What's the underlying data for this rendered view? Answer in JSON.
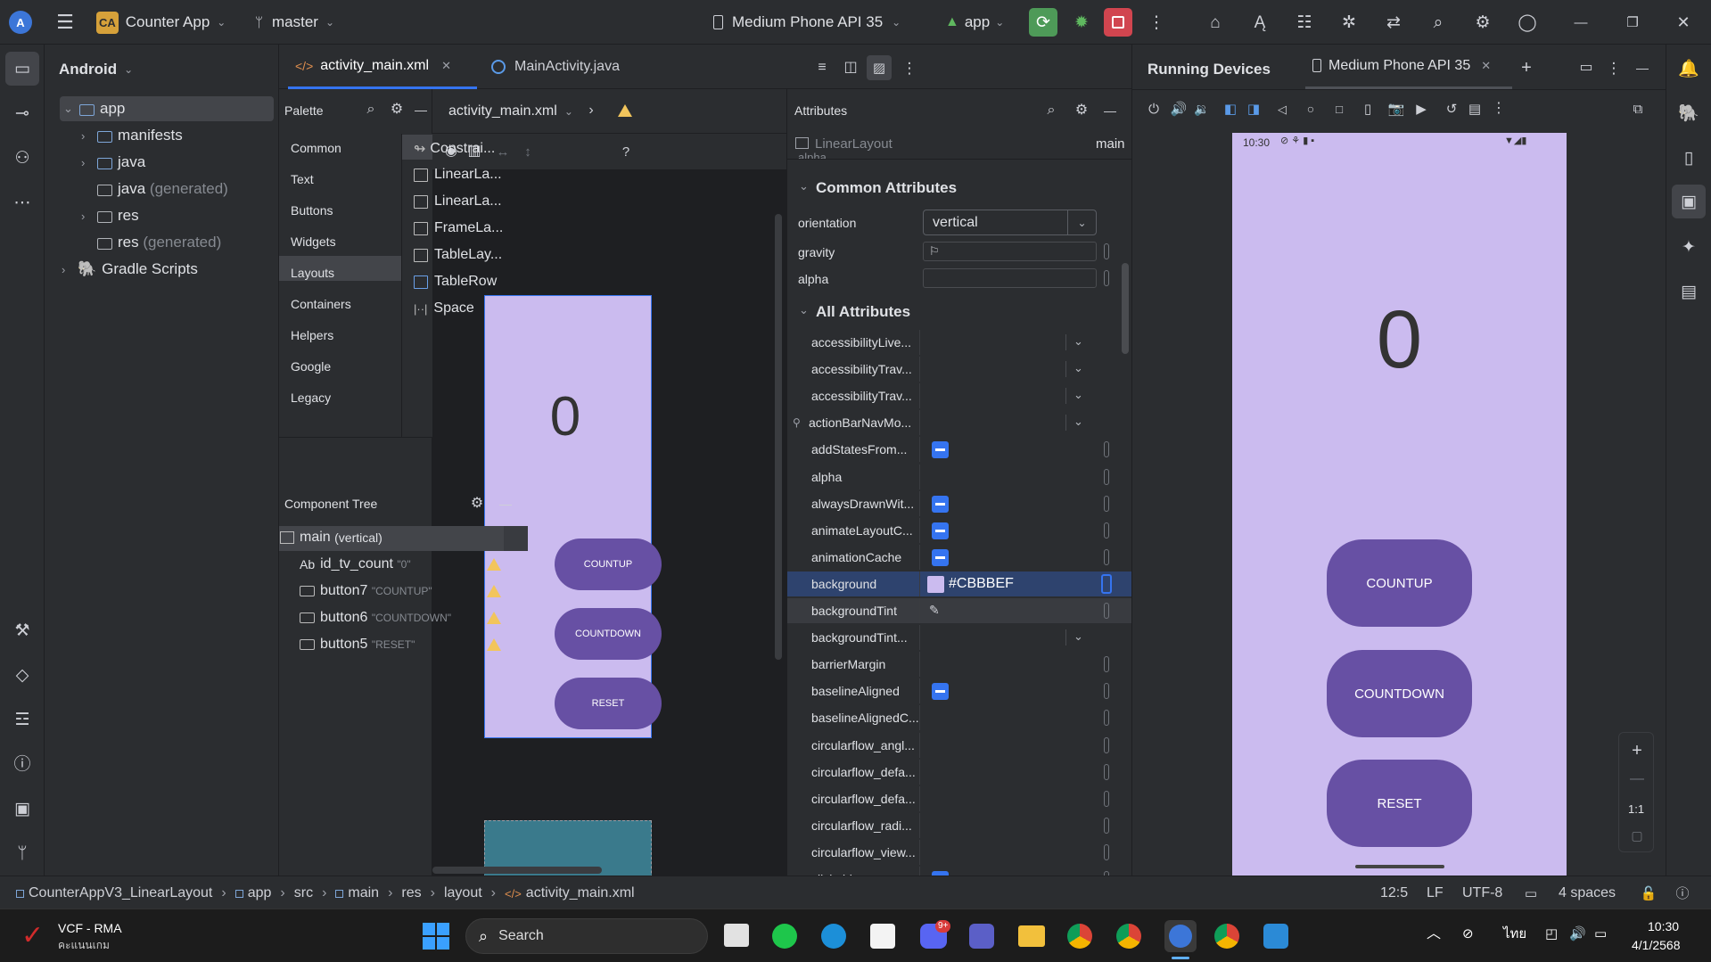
{
  "titlebar": {
    "project_badge": "CA",
    "project": "Counter App",
    "branch": "master",
    "device": "Medium Phone API 35",
    "run_config": "app"
  },
  "project_panel": {
    "view": "Android",
    "items": [
      {
        "label": "app",
        "suffix": ""
      },
      {
        "label": "manifests",
        "suffix": ""
      },
      {
        "label": "java",
        "suffix": ""
      },
      {
        "label": "java",
        "suffix": "(generated)"
      },
      {
        "label": "res",
        "suffix": ""
      },
      {
        "label": "res",
        "suffix": "(generated)"
      },
      {
        "label": "Gradle Scripts",
        "suffix": ""
      }
    ]
  },
  "editor": {
    "tabs": [
      {
        "label": "activity_main.xml"
      },
      {
        "label": "MainActivity.java"
      }
    ],
    "file_dropdown": "activity_main.xml"
  },
  "palette": {
    "title": "Palette",
    "categories": [
      "Common",
      "Text",
      "Buttons",
      "Widgets",
      "Layouts",
      "Containers",
      "Helpers",
      "Google",
      "Legacy"
    ],
    "selected": "Layouts",
    "items": [
      "Constrai...",
      "LinearLa...",
      "LinearLa...",
      "FrameLa...",
      "TableLay...",
      "TableRow",
      "Space"
    ]
  },
  "component_tree": {
    "title": "Component Tree",
    "root": "main",
    "root_suffix": "(vertical)",
    "children": [
      {
        "id": "id_tv_count",
        "text": "\"0\"",
        "prefix": "Ab"
      },
      {
        "id": "button7",
        "text": "\"COUNTUP\""
      },
      {
        "id": "button6",
        "text": "\"COUNTDOWN\""
      },
      {
        "id": "button5",
        "text": "\"RESET\""
      }
    ]
  },
  "design": {
    "count": "0",
    "buttons": [
      "COUNTUP",
      "COUNTDOWN",
      "RESET"
    ],
    "bg": "#CBBBEF",
    "button_color": "#6750a4"
  },
  "attributes": {
    "title": "Attributes",
    "view_class": "LinearLayout",
    "view_id": "main",
    "alpha_hidden": "alpha",
    "common_header": "Common Attributes",
    "common": [
      {
        "name": "orientation",
        "value": "vertical"
      },
      {
        "name": "gravity",
        "value": ""
      },
      {
        "name": "alpha",
        "value": ""
      }
    ],
    "all_header": "All Attributes",
    "all": [
      {
        "name": "accessibilityLive...",
        "type": "dropdown"
      },
      {
        "name": "accessibilityTrav...",
        "type": "dropdown"
      },
      {
        "name": "accessibilityTrav...",
        "type": "dropdown"
      },
      {
        "name": "actionBarNavMo...",
        "type": "dropdown"
      },
      {
        "name": "addStatesFrom...",
        "type": "check"
      },
      {
        "name": "alpha",
        "type": "empty"
      },
      {
        "name": "alwaysDrawnWit...",
        "type": "check"
      },
      {
        "name": "animateLayoutC...",
        "type": "check"
      },
      {
        "name": "animationCache",
        "type": "check"
      },
      {
        "name": "background",
        "type": "color",
        "value": "#CBBBEF"
      },
      {
        "name": "backgroundTint",
        "type": "picker"
      },
      {
        "name": "backgroundTint...",
        "type": "dropdown"
      },
      {
        "name": "barrierMargin",
        "type": "empty"
      },
      {
        "name": "baselineAligned",
        "type": "check"
      },
      {
        "name": "baselineAlignedC...",
        "type": "empty"
      },
      {
        "name": "circularflow_angl...",
        "type": "empty"
      },
      {
        "name": "circularflow_defa...",
        "type": "empty"
      },
      {
        "name": "circularflow_defa...",
        "type": "empty"
      },
      {
        "name": "circularflow_radi...",
        "type": "empty"
      },
      {
        "name": "circularflow_view...",
        "type": "empty"
      },
      {
        "name": "clickable",
        "type": "check"
      }
    ]
  },
  "running_devices": {
    "title": "Running Devices",
    "tab": "Medium Phone API 35",
    "time": "10:30",
    "count": "0",
    "buttons": [
      "COUNTUP",
      "COUNTDOWN",
      "RESET"
    ],
    "zoom": "1:1"
  },
  "statusbar": {
    "crumbs": [
      "CounterAppV3_LinearLayout",
      "app",
      "src",
      "main",
      "res",
      "layout",
      "activity_main.xml"
    ],
    "position": "12:5",
    "line_sep": "LF",
    "encoding": "UTF-8",
    "indent": "4 spaces"
  },
  "taskbar": {
    "weather_title": "VCF - RMA",
    "weather_sub": "คะแนนเกม",
    "search": "Search",
    "lang": "ไทย",
    "time": "10:30",
    "date": "4/1/2568",
    "notif_badge": "9+"
  }
}
